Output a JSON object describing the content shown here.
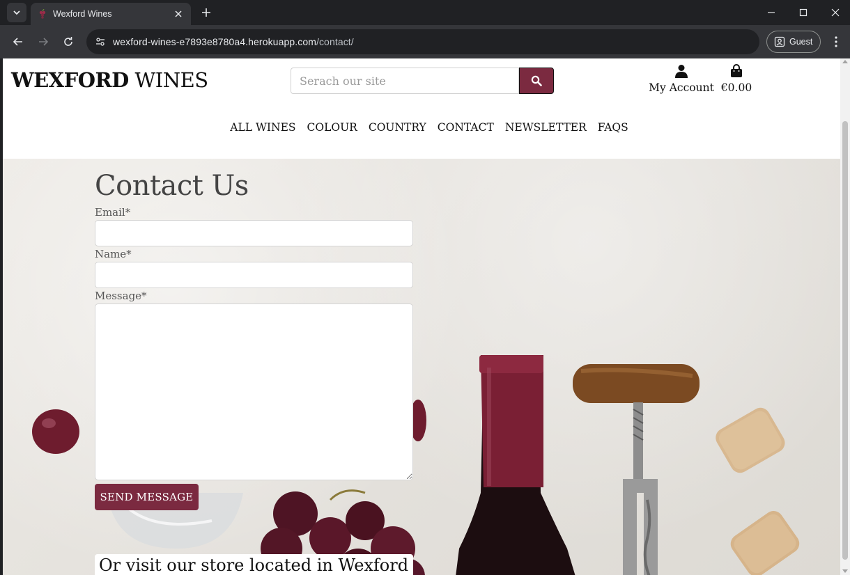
{
  "browser": {
    "tab_title": "Wexford Wines",
    "url_host": "wexford-wines-e7893e8780a4.herokuapp.com",
    "url_path": "/contact/",
    "profile_label": "Guest"
  },
  "header": {
    "logo_bold": "WEXFORD",
    "logo_rest": " WINES",
    "search_placeholder": "Serach our site",
    "account_label": "My Account",
    "bag_total": "€0.00"
  },
  "nav": {
    "items": [
      "ALL WINES",
      "COLOUR",
      "COUNTRY",
      "CONTACT",
      "NEWSLETTER",
      "FAQS"
    ]
  },
  "contact": {
    "title": "Contact Us",
    "email_label": "Email*",
    "name_label": "Name*",
    "message_label": "Message*",
    "submit_label": "SEND MESSAGE",
    "store_heading": "Or visit our store located in Wexford"
  },
  "colors": {
    "brand": "#7b2a40",
    "chrome_bg": "#202124",
    "toolbar_bg": "#35363a"
  }
}
